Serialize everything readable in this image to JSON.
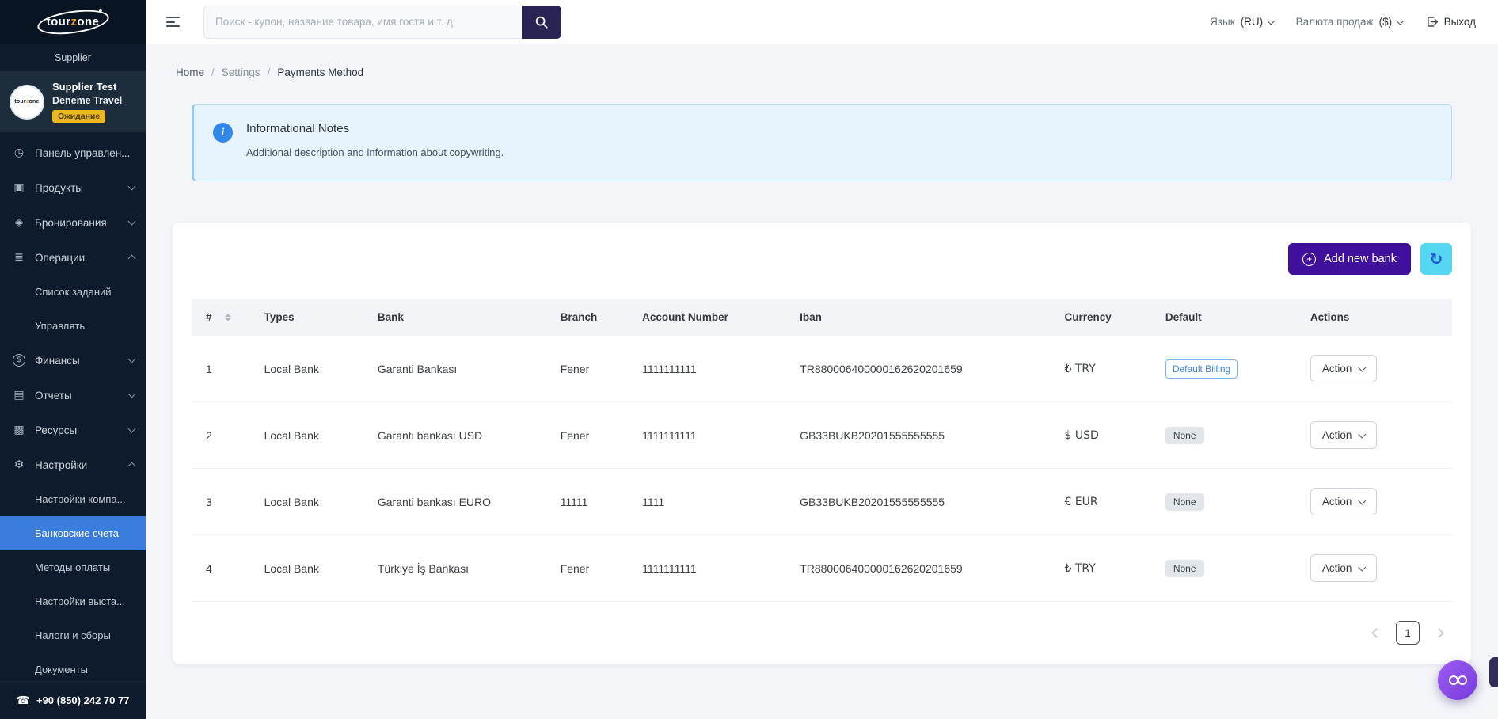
{
  "brand": {
    "logo_prefix": "tour",
    "logo_accent": "z",
    "logo_suffix": "one",
    "portal_label": "Supplier"
  },
  "profile": {
    "name": "Supplier Test",
    "company": "Deneme Travel",
    "status_badge": "Ожидание"
  },
  "sidebar": {
    "items": [
      {
        "label": "Панель управлен..."
      },
      {
        "label": "Продукты"
      },
      {
        "label": "Бронирования"
      },
      {
        "label": "Операции",
        "children": [
          {
            "label": "Список заданий"
          },
          {
            "label": "Управлять"
          }
        ]
      },
      {
        "label": "Финансы"
      },
      {
        "label": "Отчеты"
      },
      {
        "label": "Ресурсы"
      },
      {
        "label": "Настройки",
        "children": [
          {
            "label": "Настройки компа..."
          },
          {
            "label": "Банковские счета"
          },
          {
            "label": "Методы оплаты"
          },
          {
            "label": "Настройки выста..."
          },
          {
            "label": "Налоги и сборы"
          },
          {
            "label": "Документы"
          }
        ]
      }
    ],
    "active_item": "Банковские счета",
    "phone": "+90 (850) 242 70 77"
  },
  "header": {
    "search_placeholder": "Поиск - купон, название товара, имя гостя и т. д.",
    "language_label": "Язык",
    "language_value": "(RU)",
    "currency_label": "Валюта продаж",
    "currency_value": "($)",
    "logout_label": "Выход"
  },
  "breadcrumb": {
    "items": [
      "Home",
      "Settings",
      "Payments Method"
    ],
    "separator": "/"
  },
  "info_note": {
    "title": "Informational Notes",
    "description": "Additional description and information about copywriting."
  },
  "toolbar": {
    "add_bank_label": "Add new bank"
  },
  "table": {
    "columns": [
      "#",
      "Types",
      "Bank",
      "Branch",
      "Account Number",
      "Iban",
      "Currency",
      "Default",
      "Actions"
    ],
    "action_label": "Action",
    "rows": [
      {
        "num": "1",
        "types": "Local Bank",
        "bank": "Garanti Bankası",
        "branch": "Fener",
        "account_number": "1111111111",
        "iban": "TR880006400000162620201659",
        "currency": "₺ TRY",
        "default": "Default Billing"
      },
      {
        "num": "2",
        "types": "Local Bank",
        "bank": "Garanti bankası USD",
        "branch": "Fener",
        "account_number": "1111111111",
        "iban": "GB33BUKB20201555555555",
        "currency": "$ USD",
        "default": "None"
      },
      {
        "num": "3",
        "types": "Local Bank",
        "bank": "Garanti bankası EURO",
        "branch": "11111",
        "account_number": "1111",
        "iban": "GB33BUKB20201555555555",
        "currency": "€ EUR",
        "default": "None"
      },
      {
        "num": "4",
        "types": "Local Bank",
        "bank": "Türkiye İş Bankası",
        "branch": "Fener",
        "account_number": "1111111111",
        "iban": "TR880006400000162620201659",
        "currency": "₺ TRY",
        "default": "None"
      }
    ]
  },
  "pagination": {
    "current_page": "1"
  },
  "icons": {
    "gauge_icon": "◷",
    "products_icon": "▣",
    "bookings_icon": "◈",
    "operations_icon": "≣",
    "finance_icon": "$",
    "reports_icon": "▤",
    "resources_icon": "▩",
    "settings_icon": "⚙",
    "phone_icon": "☎",
    "refresh_icon": "↻",
    "plus_icon": "+",
    "info_icon": "i"
  },
  "colors": {
    "primary_purple": "#40109c",
    "accent_cyan": "#55d7f2",
    "active_blue": "#3b7ddd",
    "status_yellow": "#ecb61d",
    "info_bg": "#e7f3fd",
    "sidebar_bg": "#0e1b2c"
  }
}
